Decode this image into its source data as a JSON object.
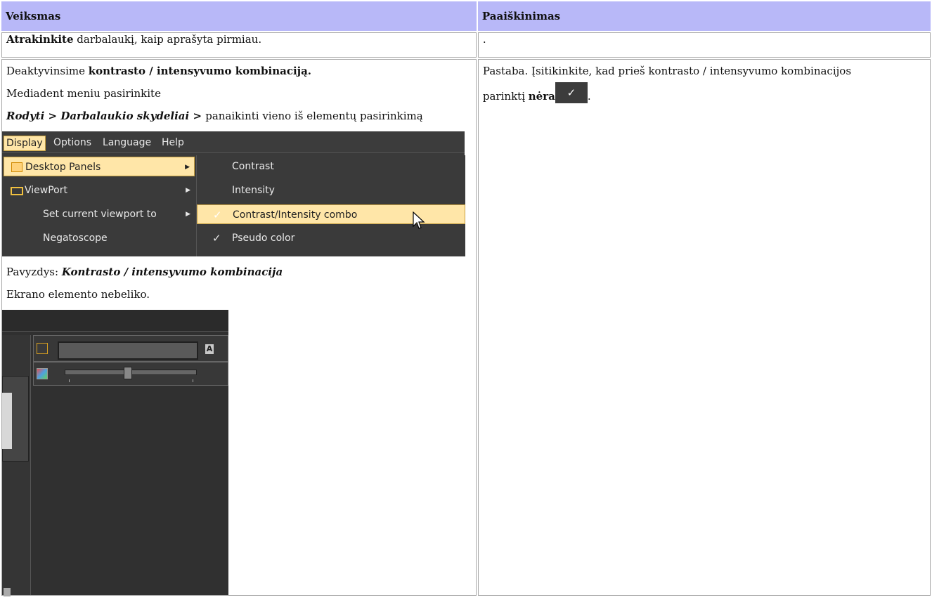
{
  "header": {
    "col_action": "Veiksmas",
    "col_explanation": "Paaiškinimas"
  },
  "row1": {
    "action_bold": "Atrakinkite",
    "action_rest": " darbalaukį, kaip aprašyta pirmiau.",
    "explanation": "."
  },
  "row2": {
    "line1_pre": "Deaktyvinsime ",
    "line1_bold": "kontrasto / intensyvumo kombinaciją.",
    "line2": "Mediadent meniu pasirinkite",
    "line3_b1": "Rodyti",
    "line3_sep1": " > ",
    "line3_b2": "Darbalaukio skydeliai",
    "line3_sep2": " > ",
    "line3_rest": "panaikinti vieno iš elementų pasirinkimą",
    "example_pre": "Pavyzdys: ",
    "example_bold": "Kontrasto / intensyvumo kombinacija",
    "result": "Ekrano elemento nebeliko.",
    "note_line1": "Pastaba. Įsitikinkite, kad prieš kontrasto / intensyvumo kombinacijos",
    "note_pre": "parinktį ",
    "note_bold": "nėra",
    "note_end": ".",
    "check_glyph": "✓"
  },
  "menu": {
    "bar": [
      "Display",
      "Options",
      "Language",
      "Help"
    ],
    "left_items": [
      "Desktop Panels",
      "ViewPort",
      "Set current viewport to",
      "Negatoscope"
    ],
    "right_items": [
      "Contrast",
      "Intensity",
      "Contrast/Intensity combo",
      "Pseudo color"
    ],
    "check_glyph": "✓",
    "submenu_arrow": "▶"
  },
  "panel": {
    "a_button": "A"
  }
}
